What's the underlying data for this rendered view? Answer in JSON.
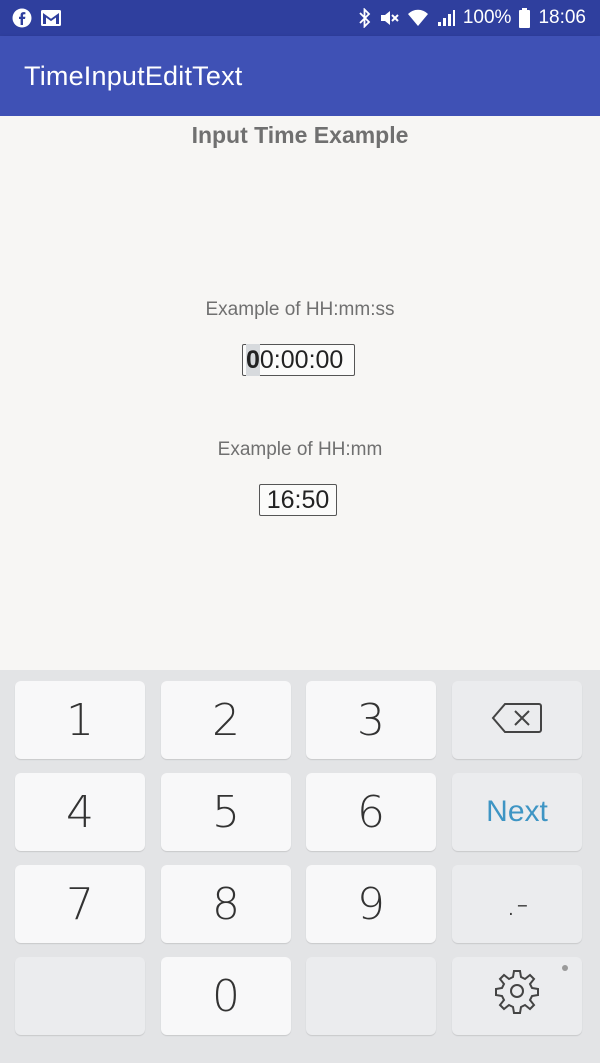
{
  "status_bar": {
    "battery_text": "100%",
    "time": "18:06",
    "icons": [
      "facebook-icon",
      "gmail-icon",
      "bluetooth-icon",
      "mute-icon",
      "wifi-icon",
      "signal-icon",
      "battery-icon"
    ]
  },
  "app_bar": {
    "title": "TimeInputEditText"
  },
  "content": {
    "heading": "Input Time Example",
    "example1": {
      "label": "Example of HH:mm:ss",
      "cursor_char": "0",
      "value_rest": "0:00:00"
    },
    "example2": {
      "label": "Example of HH:mm",
      "value": "16:50"
    }
  },
  "keyboard": {
    "keys": {
      "k1": "1",
      "k2": "2",
      "k3": "3",
      "k4": "4",
      "k5": "5",
      "k6": "6",
      "k7": "7",
      "k8": "8",
      "k9": "9",
      "k0": "0",
      "next": "Next",
      "symbols": ".-"
    },
    "icons": [
      "backspace-icon",
      "settings-gear-icon"
    ]
  },
  "colors": {
    "status_bar": "#2f3f9e",
    "app_bar": "#3f51b5",
    "next_key": "#3e95c4",
    "keyboard_bg": "#e3e4e6"
  }
}
